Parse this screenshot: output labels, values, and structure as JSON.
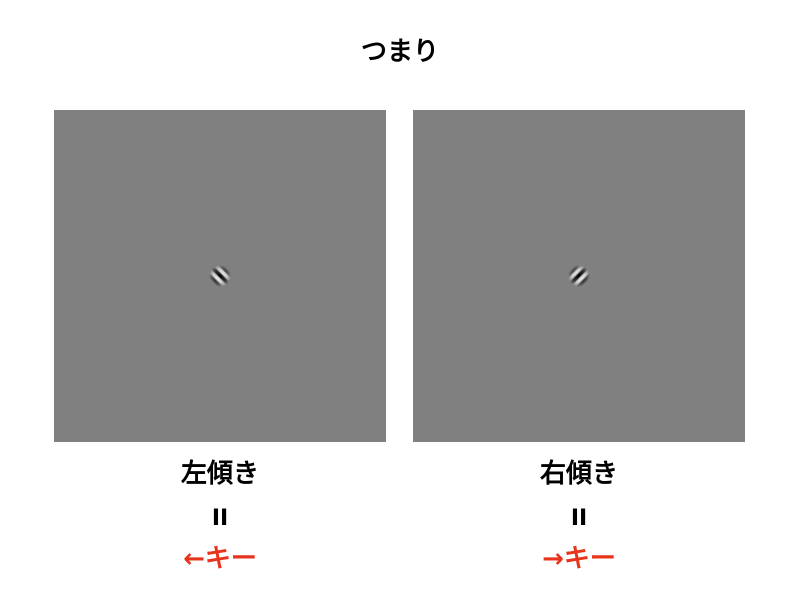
{
  "heading": "つまり",
  "panels": [
    {
      "stimulus": "gabor-patch",
      "orientation": "left-tilt",
      "label": "左傾き",
      "equals": "II",
      "key_label": "←キー"
    },
    {
      "stimulus": "gabor-patch",
      "orientation": "right-tilt",
      "label": "右傾き",
      "equals": "II",
      "key_label": "→キー"
    }
  ],
  "colors": {
    "background": "#ffffff",
    "stimulus_gray": "#808080",
    "text": "#000000",
    "key_accent": "#e8341c"
  }
}
